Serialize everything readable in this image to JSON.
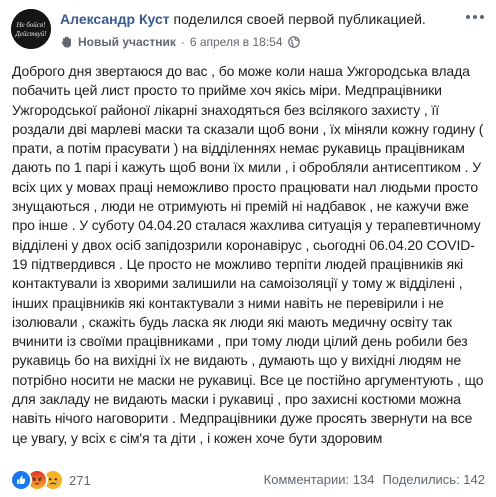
{
  "post": {
    "author": "Александр Куст",
    "action": "поделился своей первой публикацией.",
    "badge_label": "Новый участник",
    "timestamp": "6 апреля в 18:54",
    "separator": "·",
    "avatar_text_line1": "Не бойся!",
    "avatar_text_line2": "Действуй!",
    "body": "Доброго дня звертаюся до вас , бо може коли наша Ужгородська влада побачить цей лист просто то прийме хоч якісь міри. Медпрацівники Ужгородської районої лікарні знаходяться без всілякого захисту , її роздали дві марлеві маски та сказали щоб вони , їх міняли кожну годину ( прати, а потім прасувати ) на відділеннях немає рукавиць працівникам дають по 1 парі і кажуть щоб вони їх мили , і обробляли антисептиком . У всіх цих у мовах праці неможливо просто працювати нал людьми просто знущаються , люди не отримують ні премій ні надбавок , не кажучи вже про інше . У суботу 04.04.20 сталася жахлива ситуація у терапевтичному відділені у двох осіб запідозрили коронавірус , сьогодні 06.04.20 COVID-19 підтвердився . Це просто не можливо терпіти людей працівників які контактували із хворими залишили на самоізоляції у тому ж відділені , інших працівників які контактували з ними навіть не перевірили і не ізолювали , скажіть будь ласка як люди які мають медичну освіту так вчинити із своїми працівниками , при тому люди цілий день робили без рукавиць бо на вихідні їх не видають , думають що у вихідні людям не потрібно носити не маски не рукавиці. Все це постійно аргументують , що для закладу не видають маски і рукавиці , про захисні костюми можна навіть нічого наговорити . Медпрацівники дуже просять звернути на все це увагу, у всіх є сім'я та діти , і кожен хоче бути здоровим"
  },
  "footer": {
    "reactions_count": "271",
    "comments_label": "Комментарии: 134",
    "shares_label": "Поделились: 142"
  },
  "colors": {
    "author_link": "#385898",
    "meta_text": "#616770",
    "body_text": "#1c1e21",
    "like_blue": "#1877f2",
    "angry_orange": "#f7714c",
    "sad_yellow": "#f7b125"
  },
  "icons": {
    "badge": "new-member-hand-icon",
    "privacy": "globe-icon",
    "options": "more-options-icon",
    "reactions": [
      "like-reaction-icon",
      "angry-reaction-icon",
      "sad-reaction-icon"
    ]
  }
}
